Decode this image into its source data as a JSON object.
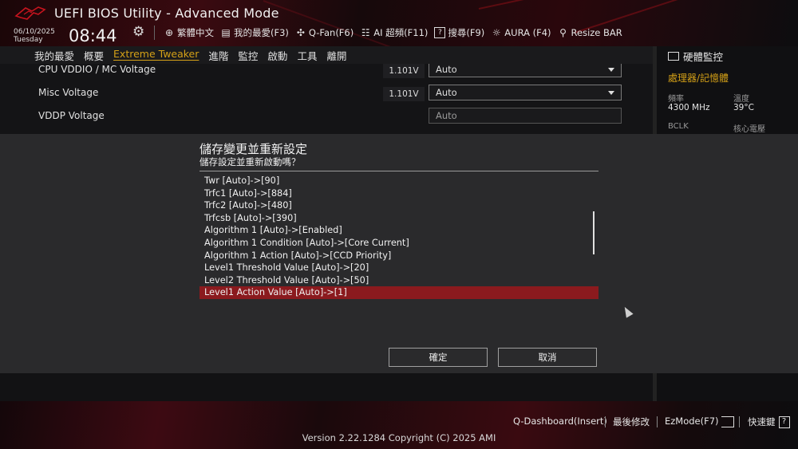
{
  "header": {
    "title": "UEFI BIOS Utility - Advanced Mode",
    "date": "06/10/2025",
    "weekday": "Tuesday",
    "time": "08:44",
    "tools": [
      {
        "icon": "globe-icon",
        "label": "繁體中文"
      },
      {
        "icon": "favorites-icon",
        "label": "我的最愛(F3)"
      },
      {
        "icon": "fan-icon",
        "label": "Q-Fan(F6)"
      },
      {
        "icon": "ai-overclock-icon",
        "label": "AI 超頻(F11)"
      },
      {
        "icon": "search-help-icon",
        "label": "搜尋(F9)"
      },
      {
        "icon": "aura-icon",
        "label": "AURA (F4)"
      },
      {
        "icon": "resize-bar-icon",
        "label": "Resize BAR"
      }
    ]
  },
  "menu": {
    "items": [
      "我的最愛",
      "概要",
      "Extreme Tweaker",
      "進階",
      "監控",
      "啟動",
      "工具",
      "離開"
    ],
    "active": "Extreme Tweaker"
  },
  "settings": [
    {
      "label": "CPU VDDIO / MC Voltage",
      "voltage": "1.101V",
      "value": "Auto"
    },
    {
      "label": "Misc Voltage",
      "voltage": "1.101V",
      "value": "Auto"
    },
    {
      "label": "VDDP Voltage",
      "voltage": "",
      "value": "Auto"
    }
  ],
  "hw_monitor": {
    "title": "硬體監控",
    "section": "處理器/記憶體",
    "freq_label": "頻率",
    "freq_value": "4300 MHz",
    "temp_label": "溫度",
    "temp_value": "39°C",
    "bclk_label": "BCLK",
    "vcore_label": "核心電壓"
  },
  "dialog": {
    "title": "儲存變更並重新設定",
    "subtitle": "儲存設定並重新啟動嗎？",
    "changes": [
      "Twr [Auto]->[90]",
      "Trfc1 [Auto]->[884]",
      "Trfc2 [Auto]->[480]",
      "Trfcsb [Auto]->[390]",
      "Algorithm 1 [Auto]->[Enabled]",
      "Algorithm 1 Condition [Auto]->[Core Current]",
      "Algorithm 1 Action [Auto]->[CCD Priority]",
      "Level1 Threshold Value [Auto]->[20]",
      "Level2 Threshold Value [Auto]->[50]",
      "Level1 Action Value [Auto]->[1]"
    ],
    "selected_index": 9,
    "ok_label": "確定",
    "cancel_label": "取消"
  },
  "footer": {
    "qdashboard": "Q-Dashboard(Insert)",
    "last_modified": "最後修改",
    "ezmode": "EzMode(F7)",
    "hotkeys": "快速鍵",
    "version": "Version 2.22.1284 Copyright (C) 2025 AMI"
  },
  "colors": {
    "accent": "#d4a017",
    "selection": "#8b1a1e",
    "brand_red": "#c8141e"
  }
}
